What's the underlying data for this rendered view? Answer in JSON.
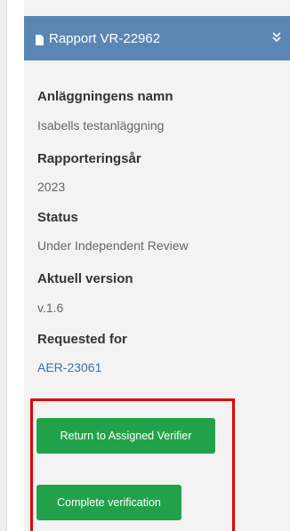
{
  "header": {
    "title": "Rapport VR-22962"
  },
  "fields": [
    {
      "label": "Anläggningens namn",
      "value": "Isabells testanläggning"
    },
    {
      "label": "Rapporteringsår",
      "value": "2023"
    },
    {
      "label": "Status",
      "value": "Under Independent Review"
    },
    {
      "label": "Aktuell version",
      "value": "v.1.6"
    },
    {
      "label": "Requested for",
      "value": "AER-23061"
    }
  ],
  "actions": {
    "return_label": "Return to Assigned Verifier",
    "complete_label": "Complete verification"
  },
  "colors": {
    "header_bg": "#5b86b4",
    "button_bg": "#21a24a",
    "highlight_border": "#e00000",
    "link": "#3f6fa8"
  },
  "icons": {
    "header_icon": "document-icon",
    "collapse_icon": "double-chevron-down-icon"
  }
}
